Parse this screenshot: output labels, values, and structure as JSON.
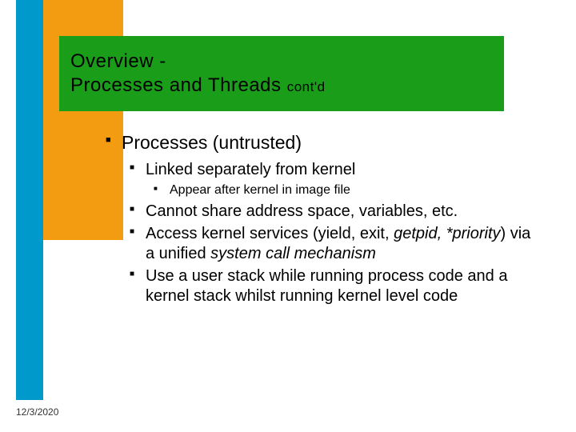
{
  "title": {
    "line1": "Overview -",
    "line2_main": "Processes and Threads ",
    "line2_sub": "cont'd"
  },
  "body": {
    "l1_1": "Processes (untrusted)",
    "l2_1": "Linked separately from kernel",
    "l3_1": "Appear after kernel in image file",
    "l2_2": "Cannot share address space, variables, etc.",
    "l2_3a": "Access kernel services (yield, exit, ",
    "l2_3b": "getpid, *priority",
    "l2_3c": ") via a unified ",
    "l2_3d": "system call mechanism",
    "l2_4": "Use a user stack while running process code and a kernel stack whilst running kernel level code"
  },
  "footer": {
    "date": "12/3/2020"
  },
  "colors": {
    "blue": "#0099cc",
    "orange": "#f39c12",
    "green": "#1a9e1a"
  }
}
